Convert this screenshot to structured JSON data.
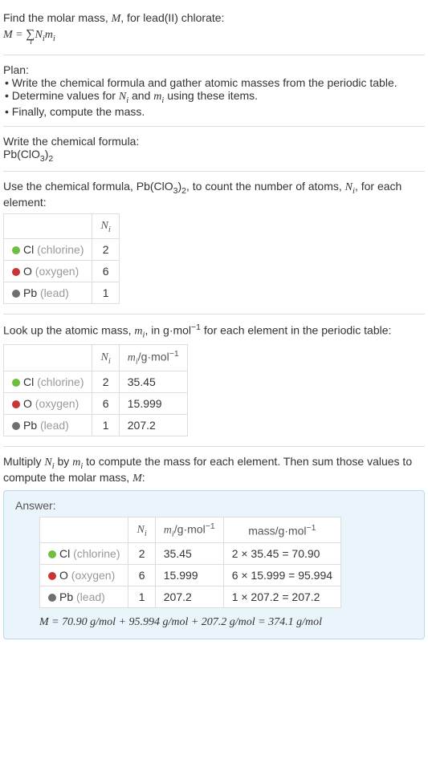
{
  "intro": {
    "line1": "Find the molar mass, ",
    "var_M": "M",
    "line1b": ", for lead(II) chlorate:",
    "eq_lhs": "M",
    "eq_eq": " = ",
    "eq_sum": "∑",
    "eq_sub": "i",
    "eq_N": "N",
    "eq_Ni": "i",
    "eq_m": "m",
    "eq_mi": "i"
  },
  "plan": {
    "heading": "Plan:",
    "item1a": "• Write the chemical formula and gather atomic masses from the periodic table.",
    "item2a": "• Determine values for ",
    "item2_N": "N",
    "item2_Ni": "i",
    "item2b": " and ",
    "item2_m": "m",
    "item2_mi": "i",
    "item2c": " using these items.",
    "item3": "• Finally, compute the mass."
  },
  "formula_section": {
    "heading": "Write the chemical formula:",
    "formula_pb": "Pb(ClO",
    "formula_3": "3",
    "formula_close": ")",
    "formula_2": "2"
  },
  "count_section": {
    "intro1": "Use the chemical formula, Pb(ClO",
    "intro_3": "3",
    "intro_close": ")",
    "intro_2": "2",
    "intro2": ", to count the number of atoms, ",
    "var_N": "N",
    "var_Ni": "i",
    "intro3": ", for each element:",
    "header_N": "N",
    "header_Ni": "i"
  },
  "elements": {
    "cl_sym": "Cl",
    "cl_name": "(chlorine)",
    "cl_N": "2",
    "cl_m": "35.45",
    "cl_mass": "2 × 35.45 = 70.90",
    "o_sym": "O",
    "o_name": "(oxygen)",
    "o_N": "6",
    "o_m": "15.999",
    "o_mass": "6 × 15.999 = 95.994",
    "pb_sym": "Pb",
    "pb_name": "(lead)",
    "pb_N": "1",
    "pb_m": "207.2",
    "pb_mass": "1 × 207.2 = 207.2"
  },
  "mass_section": {
    "intro1": "Look up the atomic mass, ",
    "var_m": "m",
    "var_mi": "i",
    "intro2": ", in g·mol",
    "sup_neg1": "−1",
    "intro3": " for each element in the periodic table:",
    "header_m": "m",
    "header_mi": "i",
    "header_unit_pre": "/g·mol",
    "header_mass": "mass/g·mol"
  },
  "multiply_section": {
    "intro1": "Multiply ",
    "var_N": "N",
    "var_Ni": "i",
    "intro2": " by ",
    "var_m": "m",
    "var_mi": "i",
    "intro3": " to compute the mass for each element. Then sum those values to compute the molar mass, ",
    "var_M": "M",
    "intro4": ":"
  },
  "answer": {
    "label": "Answer:",
    "final_M": "M",
    "final_eq": " = 70.90 g/mol + 95.994 g/mol + 207.2 g/mol = 374.1 g/mol"
  }
}
